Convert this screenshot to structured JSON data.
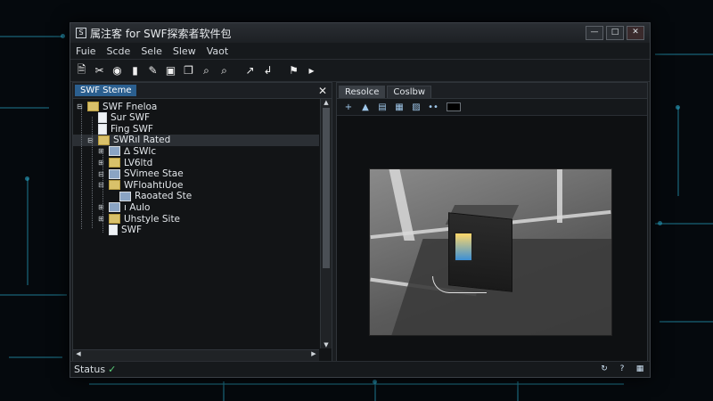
{
  "window": {
    "title": "属注客 for SWF探索者软件包"
  },
  "menu": [
    "Fuie",
    "Scde",
    "Sele",
    "Slew",
    "Vaot"
  ],
  "toolbar": [
    {
      "name": "new-file-icon",
      "glyph": "🗎"
    },
    {
      "name": "scissors-icon",
      "glyph": "✂"
    },
    {
      "name": "paint-icon",
      "glyph": "◉"
    },
    {
      "name": "eraser-icon",
      "glyph": "▮"
    },
    {
      "name": "pencil-icon",
      "glyph": "✎"
    },
    {
      "name": "shapes-icon",
      "glyph": "▣"
    },
    {
      "name": "copy-icon",
      "glyph": "❐"
    },
    {
      "name": "zoom-in-icon",
      "glyph": "⌕"
    },
    {
      "name": "zoom-out-icon",
      "glyph": "⌕"
    },
    {
      "name": "export-icon",
      "glyph": "↗"
    },
    {
      "name": "import-icon",
      "glyph": "↲"
    },
    {
      "name": "flag-icon",
      "glyph": "⚑"
    },
    {
      "name": "play-icon",
      "glyph": "▸"
    }
  ],
  "left_panel": {
    "tab": "SWF Steme",
    "tree": [
      {
        "label": "SWF Fneloa",
        "depth": 0,
        "icon": "folder",
        "exp": "⊟"
      },
      {
        "label": "Sur SWF",
        "depth": 1,
        "icon": "file",
        "exp": ""
      },
      {
        "label": "Fing SWF",
        "depth": 1,
        "icon": "file",
        "exp": ""
      },
      {
        "label": "SWRıl Rated",
        "depth": 1,
        "icon": "folder",
        "exp": "⊟"
      },
      {
        "label": "∆ SWlc",
        "depth": 2,
        "icon": "sym",
        "exp": "⊞"
      },
      {
        "label": "LV6ltd",
        "depth": 2,
        "icon": "folder",
        "exp": "⊞"
      },
      {
        "label": "SVimee Stae",
        "depth": 2,
        "icon": "sym",
        "exp": "⊟"
      },
      {
        "label": "WFloahtıUoe",
        "depth": 2,
        "icon": "folder",
        "exp": "⊟"
      },
      {
        "label": "Raoated Ste",
        "depth": 3,
        "icon": "sym",
        "exp": ""
      },
      {
        "label": "ı Aulo",
        "depth": 2,
        "icon": "sym",
        "exp": "⊞"
      },
      {
        "label": "Uhstyle Site",
        "depth": 2,
        "icon": "folder",
        "exp": "⊞"
      },
      {
        "label": "SWF",
        "depth": 2,
        "icon": "file",
        "exp": ""
      }
    ]
  },
  "right_panel": {
    "tabs": [
      "Resolce",
      "Coslbw"
    ],
    "tools": [
      {
        "name": "add-icon",
        "glyph": "+"
      },
      {
        "name": "up-icon",
        "glyph": "▲"
      },
      {
        "name": "doc-icon",
        "glyph": "▤"
      },
      {
        "name": "print-icon",
        "glyph": "▦"
      },
      {
        "name": "layers-icon",
        "glyph": "▨"
      },
      {
        "name": "dots-icon",
        "glyph": "••"
      }
    ]
  },
  "status": {
    "text": "Status",
    "icons": [
      "refresh-icon",
      "help-icon",
      "grid-icon"
    ]
  }
}
